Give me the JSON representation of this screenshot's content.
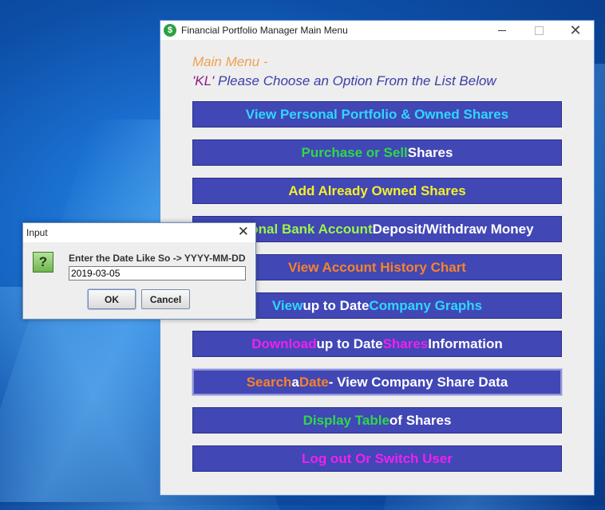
{
  "window": {
    "title": "Financial Portfolio Manager Main Menu",
    "icon_glyph": "$"
  },
  "header": {
    "line1": "Main Menu -",
    "user": "'KL'",
    "line2_rest": " Please Choose an Option From the List Below"
  },
  "menu": {
    "b1": {
      "p1": "View Personal Portfolio & Owned Shares"
    },
    "b2": {
      "p1": "Purchase or Sell",
      "p2": " Shares"
    },
    "b3": {
      "p1": "Add Already Owned Shares"
    },
    "b4": {
      "p1": "Personal Bank Account",
      "p2": " Deposit/Withdraw Money"
    },
    "b5": {
      "p1": "View Account History Chart"
    },
    "b6": {
      "p1": "View",
      "p2": " up to Date ",
      "p3": "Company Graphs"
    },
    "b7": {
      "p1": "Download",
      "p2": " up to Date ",
      "p3": "Shares",
      "p4": " Information"
    },
    "b8": {
      "p1": "Search",
      "p2": " a ",
      "p3": "Date",
      "p4": " - View Company Share Data"
    },
    "b9": {
      "p1": "Display Table",
      "p2": " of Shares"
    },
    "b10": {
      "p1": "Log out Or Switch User"
    }
  },
  "dialog": {
    "title": "Input",
    "icon_glyph": "?",
    "prompt": "Enter the Date Like So -> YYYY-MM-DD",
    "value": "2019-03-05",
    "ok_label": "OK",
    "cancel_label": "Cancel"
  },
  "colors": {
    "button_bg": "#4147b5",
    "cyan": "#2fd6ff",
    "green": "#2ed84a",
    "yellow": "#f5ef2a",
    "orange": "#f5832a",
    "magenta": "#f020f0"
  }
}
